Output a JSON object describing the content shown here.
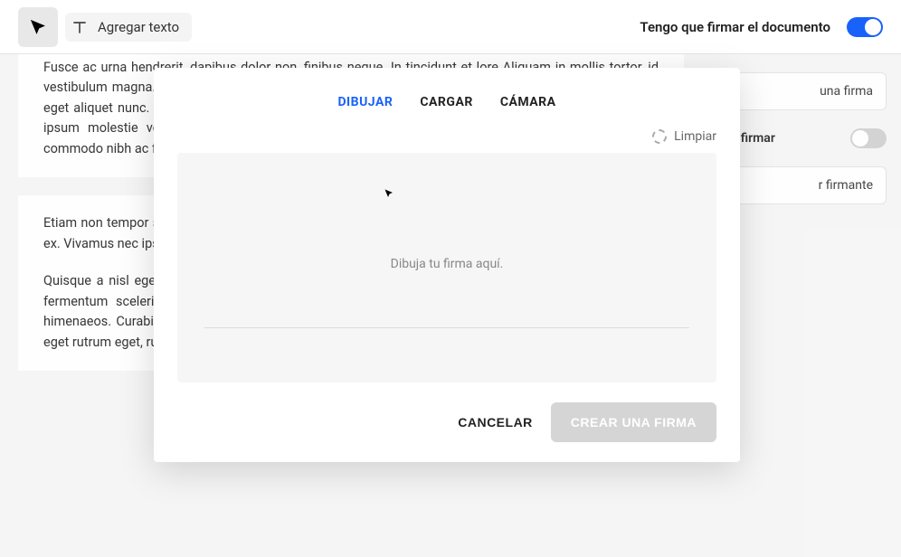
{
  "toolbar": {
    "text_tool_label": "Agregar texto",
    "sign_doc_label": "Tengo que firmar el documento"
  },
  "document": {
    "para1": "Fusce ac urna hendrerit, dapibus dolor non, finibus neque. In tincidunt et lore Aliquam in mollis tortor, id vestibulum magna. Vestibulum cursus nunc ac tincid euismod metus, nec congue odio mattis a. Donec eget aliquet nunc. Duis convallis. Praesent finibus orci sem, at convallis magna sollicitudin sed. In fring ipsum molestie vestibulum. Curabitur orci nulla, lacinia ultricies faucibus sed, vi lacus. Curabitur commodo nibh ac felis vulputate hendrerit. Integer bibendum ac quam non pellentesque.",
    "para2": "Etiam non tempor sem. Nunc interdum sem ac volutpat ornare. Ut volutpat sap ullamcorper urna est sed ex. Vivamus nec ipsum at tellus dictum vehicula.",
    "para3": "Quisque a nisl eget ante fringilla fringilla sit amet eleifend lectus. Cur vestibulum odio at mattis. Nam fermentum scelerisque maximus. Class apten ad litora torquent per conubia nostra, per inceptos himenaeos. Curabitur vene at bibendum. Cras porta massa vitae ipsum placerat faucibus. Integer nunc eget rutrum eget, rutrum feugiat velit. Aliquam erat volutpat."
  },
  "sidebar": {
    "add_signature_label": "una firma",
    "others_sign_label": "que firmar",
    "add_signer_label": "r firmante"
  },
  "modal": {
    "tabs": {
      "draw": "DIBUJAR",
      "upload": "CARGAR",
      "camera": "CÁMARA"
    },
    "clear_label": "Limpiar",
    "placeholder": "Dibuja tu firma aquí.",
    "cancel_label": "CANCELAR",
    "create_label": "CREAR UNA FIRMA"
  }
}
